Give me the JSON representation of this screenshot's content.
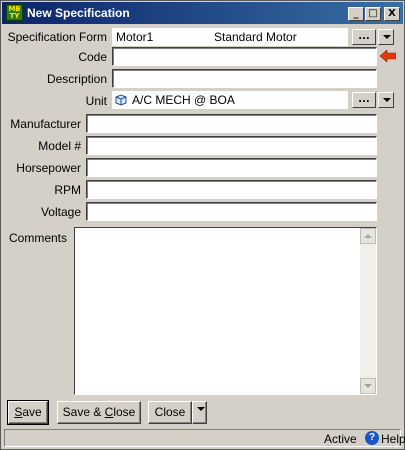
{
  "window": {
    "title": "New Specification",
    "app_icon_text": "MB TY",
    "title_buttons": {
      "minimize": "_",
      "maximize": "□",
      "close": "X"
    }
  },
  "form": {
    "spec_form": {
      "label": "Specification Form",
      "value_code": "Motor1",
      "value_name": "Standard Motor",
      "lookup_button": "..."
    },
    "code": {
      "label": "Code",
      "value": ""
    },
    "description": {
      "label": "Description",
      "value": ""
    },
    "unit": {
      "label": "Unit",
      "value": "A/C MECH @ BOA",
      "lookup_button": "..."
    },
    "manufacturer": {
      "label": "Manufacturer",
      "value": ""
    },
    "model": {
      "label": "Model #",
      "value": ""
    },
    "horsepower": {
      "label": "Horsepower",
      "value": ""
    },
    "rpm": {
      "label": "RPM",
      "value": ""
    },
    "voltage": {
      "label": "Voltage",
      "value": ""
    },
    "comments": {
      "label": "Comments",
      "value": ""
    }
  },
  "buttons": {
    "save_mnemonic": "S",
    "save_rest": "ave",
    "save_close_pre": "Save & ",
    "save_close_mnemonic": "C",
    "save_close_rest": "lose",
    "close": "Close"
  },
  "status": {
    "state": "Active",
    "help_icon": "?",
    "help_label": "Help"
  },
  "colors": {
    "required_arrow": "#e03a0c",
    "titlebar_start": "#0a246a",
    "titlebar_end": "#3a6ea5"
  }
}
